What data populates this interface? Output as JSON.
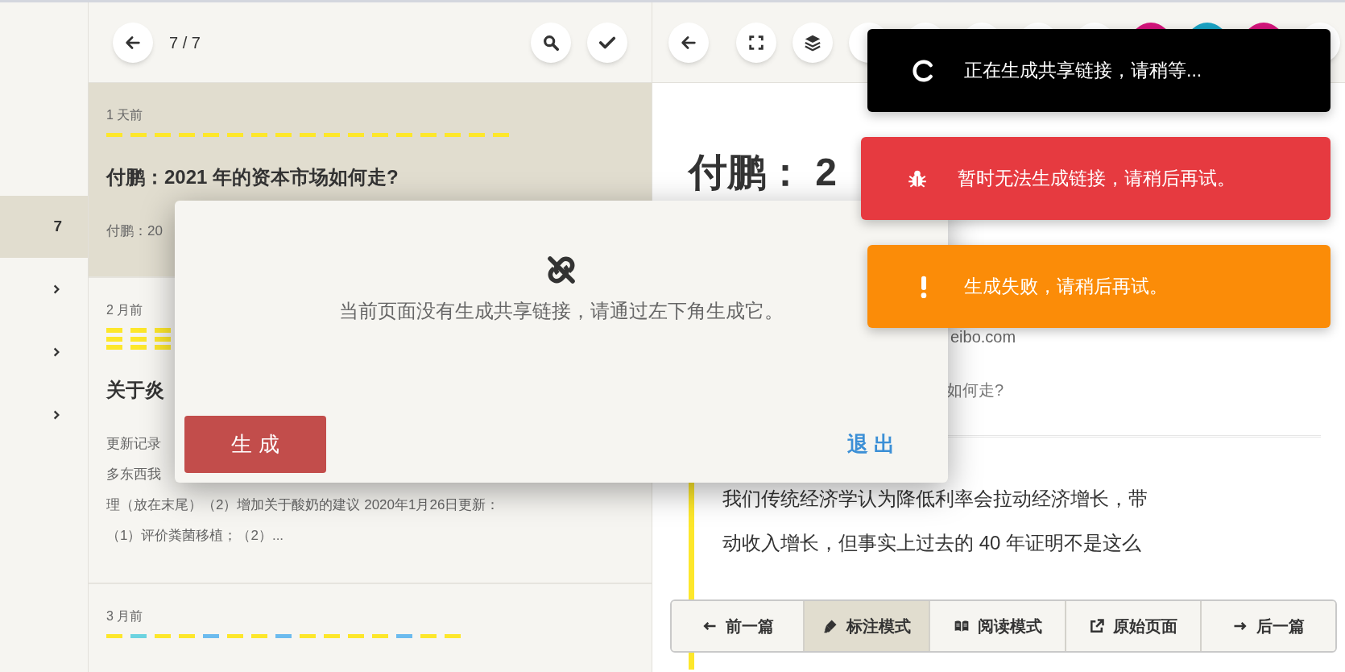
{
  "sidebar": {
    "items": [
      {
        "kind": "count",
        "label": "7",
        "selected": true
      },
      {
        "kind": "chevron",
        "selected": false
      },
      {
        "kind": "chevron",
        "selected": false
      },
      {
        "kind": "chevron",
        "selected": false
      }
    ]
  },
  "list": {
    "position": "7 / 7",
    "cards": [
      {
        "time": "1 天前",
        "selected": true,
        "marks": [
          {
            "kind": "dash",
            "color": "#fde72b"
          },
          {
            "kind": "dash",
            "color": "#fde72b"
          },
          {
            "kind": "dash",
            "color": "#fde72b"
          },
          {
            "kind": "dash",
            "color": "#fde72b"
          },
          {
            "kind": "dash",
            "color": "#fde72b"
          },
          {
            "kind": "dash",
            "color": "#fde72b"
          },
          {
            "kind": "dash",
            "color": "#fde72b"
          },
          {
            "kind": "dash",
            "color": "#fde72b"
          },
          {
            "kind": "dash",
            "color": "#fde72b"
          },
          {
            "kind": "dash",
            "color": "#fde72b"
          },
          {
            "kind": "dash",
            "color": "#fde72b"
          },
          {
            "kind": "dash",
            "color": "#fde72b"
          },
          {
            "kind": "dash",
            "color": "#fde72b"
          },
          {
            "kind": "dash",
            "color": "#fde72b"
          },
          {
            "kind": "dash",
            "color": "#fde72b"
          },
          {
            "kind": "dash",
            "color": "#fde72b"
          },
          {
            "kind": "dash",
            "color": "#fde72b"
          }
        ],
        "title": "付鹏：2021 年的资本市场如何走?",
        "excerpt": [
          "付鹏：20"
        ]
      },
      {
        "time": "2 月前",
        "selected": false,
        "marks": [
          {
            "kind": "triple",
            "color": "#fde72b"
          },
          {
            "kind": "triple",
            "color": "#fde72b"
          },
          {
            "kind": "triple",
            "color": "#fde72b"
          }
        ],
        "title": "关于炎",
        "excerpt": [
          "更新记录",
          "多东西我",
          "理（放在末尾）（2）增加关于酸奶的建议 2020年1月26日更新：",
          "（1）评价粪菌移植；（2）..."
        ]
      },
      {
        "time": "3 月前",
        "selected": false,
        "marks": [
          {
            "kind": "dash",
            "color": "#fde72b"
          },
          {
            "kind": "dash",
            "color": "#6cd3e0"
          },
          {
            "kind": "dash",
            "color": "#fde72b"
          },
          {
            "kind": "dash",
            "color": "#fde72b"
          },
          {
            "kind": "dash",
            "color": "#6cbbee"
          },
          {
            "kind": "dash",
            "color": "#fde72b"
          },
          {
            "kind": "dash",
            "color": "#fde72b"
          },
          {
            "kind": "dash",
            "color": "#6cbbee"
          },
          {
            "kind": "dash",
            "color": "#fde72b"
          },
          {
            "kind": "dash",
            "color": "#fde72b"
          },
          {
            "kind": "dash",
            "color": "#fde72b"
          },
          {
            "kind": "dash",
            "color": "#fde72b"
          },
          {
            "kind": "dash",
            "color": "#6cbbee"
          },
          {
            "kind": "dash",
            "color": "#fde72b"
          },
          {
            "kind": "dash",
            "color": "#fde72b"
          }
        ]
      }
    ]
  },
  "reader": {
    "toolbar": [
      {
        "kind": "back"
      },
      {
        "kind": "fullscreen"
      },
      {
        "kind": "layers"
      },
      {
        "kind": "link"
      },
      {
        "kind": "plain"
      },
      {
        "kind": "plain"
      },
      {
        "kind": "plain"
      },
      {
        "kind": "plain"
      },
      {
        "kind": "color",
        "color": "#d4157c"
      },
      {
        "kind": "color",
        "color": "#1aa3c4"
      },
      {
        "kind": "color",
        "color": "#d4157c"
      },
      {
        "kind": "plain"
      }
    ],
    "title": "付鹏： 2",
    "source": "eibo.com",
    "subtitle": "如何走?",
    "paragraph_lines": [
      "我们传统经济学认为降低利率会拉动经济增长，带",
      "动收入增长，但事实上过去的 40 年证明不是这么"
    ]
  },
  "dialog": {
    "message": "当前页面没有生成共享链接，请通过左下角生成它。",
    "buttons": [
      {
        "kind": "primary",
        "label": "生 成"
      },
      {
        "kind": "text",
        "label": "退 出"
      }
    ]
  },
  "toasts": [
    {
      "kind": "loading",
      "text": "正在生成共享链接，请稍等..."
    },
    {
      "kind": "error",
      "text": "暂时无法生成链接，请稍后再试。"
    },
    {
      "kind": "warning",
      "text": "生成失败，请稍后再试。"
    }
  ],
  "bottom_bar": [
    {
      "kind": "prev",
      "label": "前一篇",
      "selected": false
    },
    {
      "kind": "mark",
      "label": "标注模式",
      "selected": true
    },
    {
      "kind": "read",
      "label": "阅读模式",
      "selected": false
    },
    {
      "kind": "source",
      "label": "原始页面",
      "selected": false
    },
    {
      "kind": "next",
      "label": "后一篇",
      "selected": false
    }
  ]
}
